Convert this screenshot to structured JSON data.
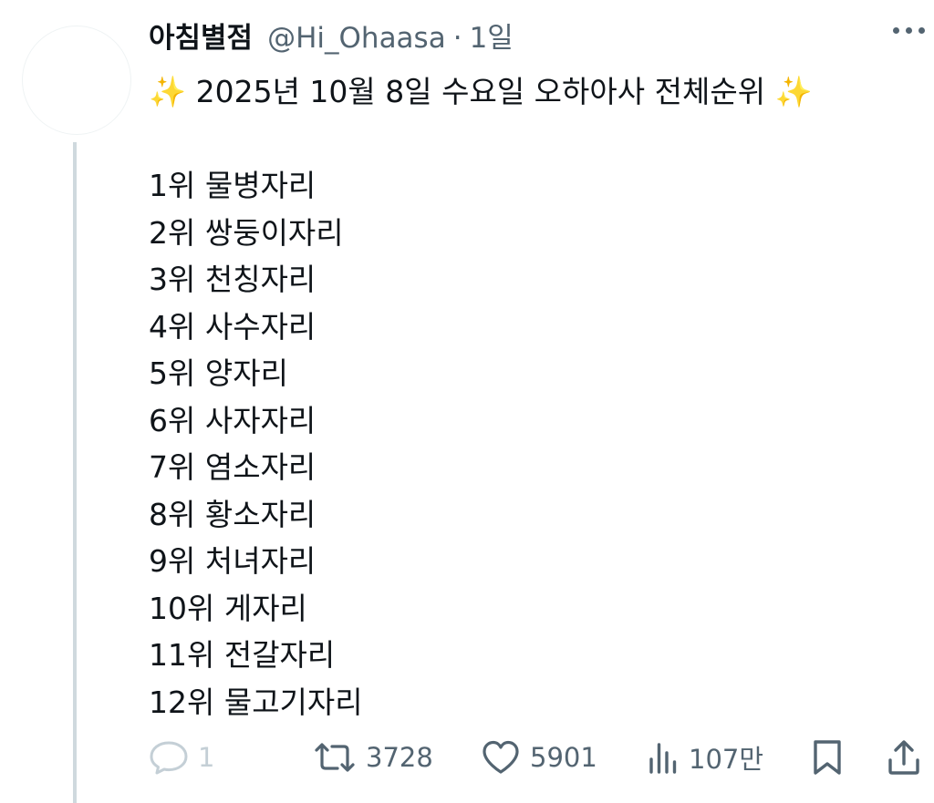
{
  "post": {
    "author_name": "아침별점",
    "handle": "@Hi_Ohaasa",
    "separator": "·",
    "time": "1일",
    "sparkle": "✨",
    "title": "2025년 10월 8일 수요일 오하아사 전체순위",
    "rankings": [
      "1위 물병자리",
      "2위 쌍둥이자리",
      "3위 천칭자리",
      "4위 사수자리",
      "5위 양자리",
      "6위 사자자리",
      "7위 염소자리",
      "8위 황소자리",
      "9위 처녀자리",
      "10위 게자리",
      "11위 전갈자리",
      "12위 물고기자리"
    ]
  },
  "actions": {
    "reply_count": "1",
    "repost_count": "3728",
    "like_count": "5901",
    "view_count": "107만"
  },
  "icons": {
    "more": "more-horizontal-icon",
    "reply": "reply-bubble-icon",
    "repost": "repost-icon",
    "like": "heart-icon",
    "views": "bar-chart-icon",
    "bookmark": "bookmark-icon",
    "share": "share-icon"
  },
  "colors": {
    "text": "#0f1419",
    "secondary": "#536471",
    "thread_line": "#cfd9de",
    "reply_faded": "#c4cfd6",
    "sparkle": "#f3c542"
  }
}
